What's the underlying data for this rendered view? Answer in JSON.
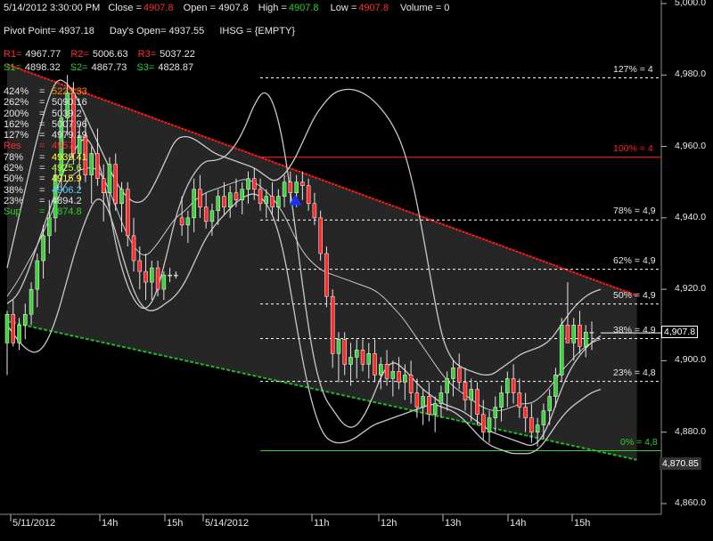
{
  "header": {
    "datetime": "5/14/2012 3:30:00 PM",
    "close_label": "Close =",
    "close": "4907.8",
    "open_label": "Open = 4907.8",
    "high_label": "High =",
    "high": "4907.8",
    "low_label": "Low =",
    "low": "4907.8",
    "volume_label": "Volume = 0",
    "pivot": "Pivot Point= 4937.18",
    "days_open": "Day's Open= 4937.55",
    "symbol": "IHSG = {EMPTY}",
    "r1_label": "R1=",
    "r1": "4967.77",
    "r2_label": "R2=",
    "r2": "5006.63",
    "r3_label": "R3=",
    "r3": "5037.22",
    "s1_label": "S1=",
    "s1": "4898.32",
    "s2_label": "S2=",
    "s2": "4867.73",
    "s3_label": "S3=",
    "s3": "4828.87"
  },
  "fib_table": [
    {
      "pct": "424%",
      "val": "5223.33",
      "color": "#ff8c1a"
    },
    {
      "pct": "262%",
      "val": "5090.16",
      "color": "#e6e6e6"
    },
    {
      "pct": "200%",
      "val": "5039.2",
      "color": "#e6e6e6"
    },
    {
      "pct": "162%",
      "val": "5007.96",
      "color": "#e6e6e6"
    },
    {
      "pct": "127%",
      "val": "4979.19",
      "color": "#e6e6e6"
    },
    {
      "pct": "Res",
      "val": "4957",
      "color": "#ff2a2a"
    },
    {
      "pct": "78%",
      "val": "4939.41",
      "color": "#ffff3a"
    },
    {
      "pct": "62%",
      "val": "4925.6",
      "color": "#b6ff3a"
    },
    {
      "pct": "50%",
      "val": "4915.9",
      "color": "#ffff3a"
    },
    {
      "pct": "38%",
      "val": "4906.2",
      "color": "#5ad2ff"
    },
    {
      "pct": "23%",
      "val": "4894.2",
      "color": "#e6e6e6"
    },
    {
      "pct": "Sup",
      "val": "4874.8",
      "color": "#2bd12b"
    }
  ],
  "chart_data": {
    "type": "candlestick",
    "ylim": [
      4857,
      5001
    ],
    "y_ticks": [
      "5,000.0",
      "4,980.0",
      "4,960.0",
      "4,940.0",
      "4,920.0",
      "4,900.0",
      "4,880.0",
      "4,860.0"
    ],
    "x_ticks": [
      "5/11/2012",
      "14h",
      "15h",
      "5/14/2012",
      "11h",
      "12h",
      "13h",
      "14h",
      "15h"
    ],
    "fib_levels": [
      {
        "label": "127% = 4",
        "value": 4979.19,
        "color": "#ffffff"
      },
      {
        "label": "100% = 4",
        "value": 4957,
        "color": "#ff2020"
      },
      {
        "label": "78% = 4,9",
        "value": 4939.41,
        "color": "#ffffff"
      },
      {
        "label": "62% = 4,9",
        "value": 4925.6,
        "color": "#ffffff"
      },
      {
        "label": "50% = 4,9",
        "value": 4915.9,
        "color": "#ffffff"
      },
      {
        "label": "38% = 4,9",
        "value": 4906.2,
        "color": "#ffffff"
      },
      {
        "label": "23% = 4,8",
        "value": 4894.2,
        "color": "#ffffff"
      },
      {
        "label": "0% = 4,8",
        "value": 4874.8,
        "color": "#2bd12b"
      }
    ],
    "last_price": "4,907.8",
    "last_value": 4907.8,
    "axis_marker": "4,870.85",
    "axis_marker_value": 4870.85,
    "upper_channel": [
      [
        0,
        4983
      ],
      [
        103,
        4918
      ]
    ],
    "lower_channel": [
      [
        0,
        4911
      ],
      [
        103,
        4872
      ]
    ],
    "signal_index": 49,
    "candles": [
      [
        4905,
        4914,
        4896,
        4913
      ],
      [
        4913,
        4917,
        4904,
        4905
      ],
      [
        4905,
        4912,
        4903,
        4910
      ],
      [
        4910,
        4916,
        4906,
        4913
      ],
      [
        4913,
        4922,
        4910,
        4920
      ],
      [
        4920,
        4930,
        4915,
        4928
      ],
      [
        4928,
        4938,
        4923,
        4935
      ],
      [
        4935,
        4945,
        4930,
        4940
      ],
      [
        4940,
        4955,
        4936,
        4952
      ],
      [
        4952,
        4972,
        4948,
        4968
      ],
      [
        4968,
        4980,
        4963,
        4975
      ],
      [
        4975,
        4978,
        4955,
        4958
      ],
      [
        4958,
        4966,
        4948,
        4963
      ],
      [
        4963,
        4968,
        4950,
        4952
      ],
      [
        4952,
        4960,
        4944,
        4958
      ],
      [
        4958,
        4965,
        4949,
        4951
      ],
      [
        4951,
        4955,
        4939,
        4947
      ],
      [
        4947,
        4957,
        4943,
        4955
      ],
      [
        4955,
        4958,
        4942,
        4944
      ],
      [
        4944,
        4950,
        4936,
        4948
      ],
      [
        4948,
        4950,
        4932,
        4935
      ],
      [
        4935,
        4940,
        4925,
        4928
      ],
      [
        4928,
        4932,
        4920,
        4925
      ],
      [
        4925,
        4930,
        4917,
        4922
      ],
      [
        4922,
        4928,
        4917,
        4926
      ],
      [
        4926,
        4928,
        4918,
        4920
      ],
      [
        4920,
        4925,
        4917,
        4924
      ],
      [
        4924,
        4926,
        4922,
        4924
      ],
      [
        4924,
        4925,
        4923,
        4924
      ],
      [
        4940,
        4946,
        4935,
        4938
      ],
      [
        4938,
        4942,
        4933,
        4940
      ],
      [
        4940,
        4951,
        4936,
        4948
      ],
      [
        4948,
        4952,
        4940,
        4943
      ],
      [
        4943,
        4947,
        4937,
        4939
      ],
      [
        4939,
        4944,
        4935,
        4942
      ],
      [
        4942,
        4948,
        4938,
        4946
      ],
      [
        4946,
        4950,
        4941,
        4943
      ],
      [
        4943,
        4949,
        4940,
        4947
      ],
      [
        4947,
        4951,
        4943,
        4945
      ],
      [
        4945,
        4950,
        4941,
        4948
      ],
      [
        4948,
        4953,
        4944,
        4951
      ],
      [
        4951,
        4954,
        4945,
        4948
      ],
      [
        4948,
        4951,
        4942,
        4944
      ],
      [
        4944,
        4948,
        4940,
        4946
      ],
      [
        4946,
        4950,
        4941,
        4943
      ],
      [
        4943,
        4948,
        4939,
        4946
      ],
      [
        4946,
        4952,
        4943,
        4950
      ],
      [
        4950,
        4953,
        4944,
        4947
      ],
      [
        4947,
        4952,
        4943,
        4950
      ],
      [
        4950,
        4953,
        4945,
        4949
      ],
      [
        4949,
        4951,
        4942,
        4944
      ],
      [
        4944,
        4947,
        4938,
        4940
      ],
      [
        4940,
        4942,
        4928,
        4930
      ],
      [
        4930,
        4932,
        4915,
        4918
      ],
      [
        4918,
        4920,
        4898,
        4902
      ],
      [
        4902,
        4908,
        4894,
        4906
      ],
      [
        4906,
        4908,
        4896,
        4899
      ],
      [
        4899,
        4905,
        4893,
        4901
      ],
      [
        4901,
        4906,
        4895,
        4903
      ],
      [
        4903,
        4906,
        4897,
        4899
      ],
      [
        4899,
        4905,
        4895,
        4902
      ],
      [
        4902,
        4906,
        4894,
        4896
      ],
      [
        4896,
        4901,
        4892,
        4899
      ],
      [
        4899,
        4903,
        4893,
        4895
      ],
      [
        4895,
        4900,
        4890,
        4897
      ],
      [
        4897,
        4901,
        4892,
        4894
      ],
      [
        4894,
        4899,
        4889,
        4896
      ],
      [
        4896,
        4900,
        4888,
        4891
      ],
      [
        4891,
        4895,
        4884,
        4887
      ],
      [
        4887,
        4892,
        4882,
        4890
      ],
      [
        4890,
        4894,
        4883,
        4885
      ],
      [
        4885,
        4890,
        4880,
        4888
      ],
      [
        4888,
        4893,
        4884,
        4891
      ],
      [
        4891,
        4897,
        4886,
        4895
      ],
      [
        4895,
        4900,
        4890,
        4898
      ],
      [
        4898,
        4902,
        4892,
        4894
      ],
      [
        4894,
        4898,
        4886,
        4889
      ],
      [
        4889,
        4895,
        4883,
        4892
      ],
      [
        4892,
        4894,
        4882,
        4885
      ],
      [
        4885,
        4889,
        4878,
        4880
      ],
      [
        4880,
        4886,
        4877,
        4884
      ],
      [
        4884,
        4890,
        4880,
        4887
      ],
      [
        4887,
        4893,
        4883,
        4891
      ],
      [
        4891,
        4897,
        4887,
        4895
      ],
      [
        4895,
        4899,
        4888,
        4891
      ],
      [
        4891,
        4895,
        4884,
        4887
      ],
      [
        4887,
        4891,
        4880,
        4884
      ],
      [
        4884,
        4888,
        4877,
        4880
      ],
      [
        4880,
        4884,
        4876,
        4882
      ],
      [
        4882,
        4888,
        4878,
        4886
      ],
      [
        4886,
        4892,
        4882,
        4890
      ],
      [
        4890,
        4898,
        4887,
        4896
      ],
      [
        4896,
        4912,
        4894,
        4910
      ],
      [
        4910,
        4922,
        4905,
        4905
      ],
      [
        4905,
        4912,
        4900,
        4910
      ],
      [
        4910,
        4914,
        4902,
        4904
      ],
      [
        4904,
        4910,
        4901,
        4908
      ],
      [
        4908,
        4911,
        4903,
        4907.8
      ]
    ],
    "upper_band": [
      4926,
      4938,
      4950,
      4962,
      4972,
      4979,
      4978,
      4974,
      4968,
      4962,
      4956,
      4950,
      4946,
      4944,
      4945,
      4950,
      4956,
      4962,
      4963,
      4962,
      4960,
      4958,
      4957,
      4956,
      4955,
      4954,
      4952,
      4950,
      4952,
      4956,
      4962,
      4968,
      4972,
      4975,
      4976,
      4976,
      4975,
      4973,
      4970,
      4966,
      4960,
      4950,
      4936,
      4920,
      4906,
      4900,
      4898,
      4897,
      4896,
      4896,
      4898,
      4900,
      4902,
      4903,
      4904,
      4906,
      4910,
      4914,
      4917,
      4919,
      4920
    ],
    "lower_band": [
      4910,
      4906,
      4903,
      4902,
      4905,
      4912,
      4922,
      4932,
      4940,
      4946,
      4944,
      4936,
      4926,
      4918,
      4914,
      4914,
      4916,
      4918,
      4922,
      4928,
      4934,
      4938,
      4941,
      4944,
      4946,
      4947,
      4945,
      4940,
      4930,
      4914,
      4898,
      4886,
      4879,
      4877,
      4877,
      4878,
      4880,
      4882,
      4883,
      4884,
      4885,
      4886,
      4887,
      4888,
      4887,
      4886,
      4884,
      4881,
      4878,
      4876,
      4875,
      4874,
      4874,
      4874,
      4876,
      4880,
      4884,
      4887,
      4889,
      4891,
      4892
    ],
    "mid_line": [
      4918,
      4922,
      4927,
      4932,
      4938,
      4945,
      4950,
      4953,
      4954,
      4954,
      4950,
      4943,
      4936,
      4931,
      4929,
      4932,
      4936,
      4940,
      4942,
      4945,
      4947,
      4948,
      4949,
      4950,
      4951,
      4950,
      4948,
      4945,
      4941,
      4935,
      4930,
      4927,
      4925,
      4924,
      4923,
      4922,
      4921,
      4920,
      4918,
      4915,
      4912,
      4908,
      4904,
      4900,
      4896,
      4893,
      4891,
      4889,
      4887,
      4886,
      4886,
      4887,
      4888,
      4888,
      4890,
      4893,
      4897,
      4900,
      4903,
      4905,
      4906
    ],
    "wave_line": [
      4916,
      4918,
      4924,
      4932,
      4940,
      4948,
      4955,
      4960,
      4963,
      4958,
      4948,
      4932,
      4922,
      4916,
      4914,
      4918,
      4928,
      4940,
      4948,
      4953,
      4956,
      4956,
      4957,
      4960,
      4965,
      4972,
      4976,
      4972,
      4960,
      4940,
      4918,
      4900,
      4890,
      4886,
      4882,
      4881,
      4884,
      4890,
      4897,
      4900,
      4898,
      4895,
      4892,
      4890,
      4888,
      4887,
      4886,
      4884,
      4882,
      4880,
      4879,
      4878,
      4877,
      4876,
      4878,
      4884,
      4892,
      4898,
      4902,
      4905,
      4907
    ]
  }
}
